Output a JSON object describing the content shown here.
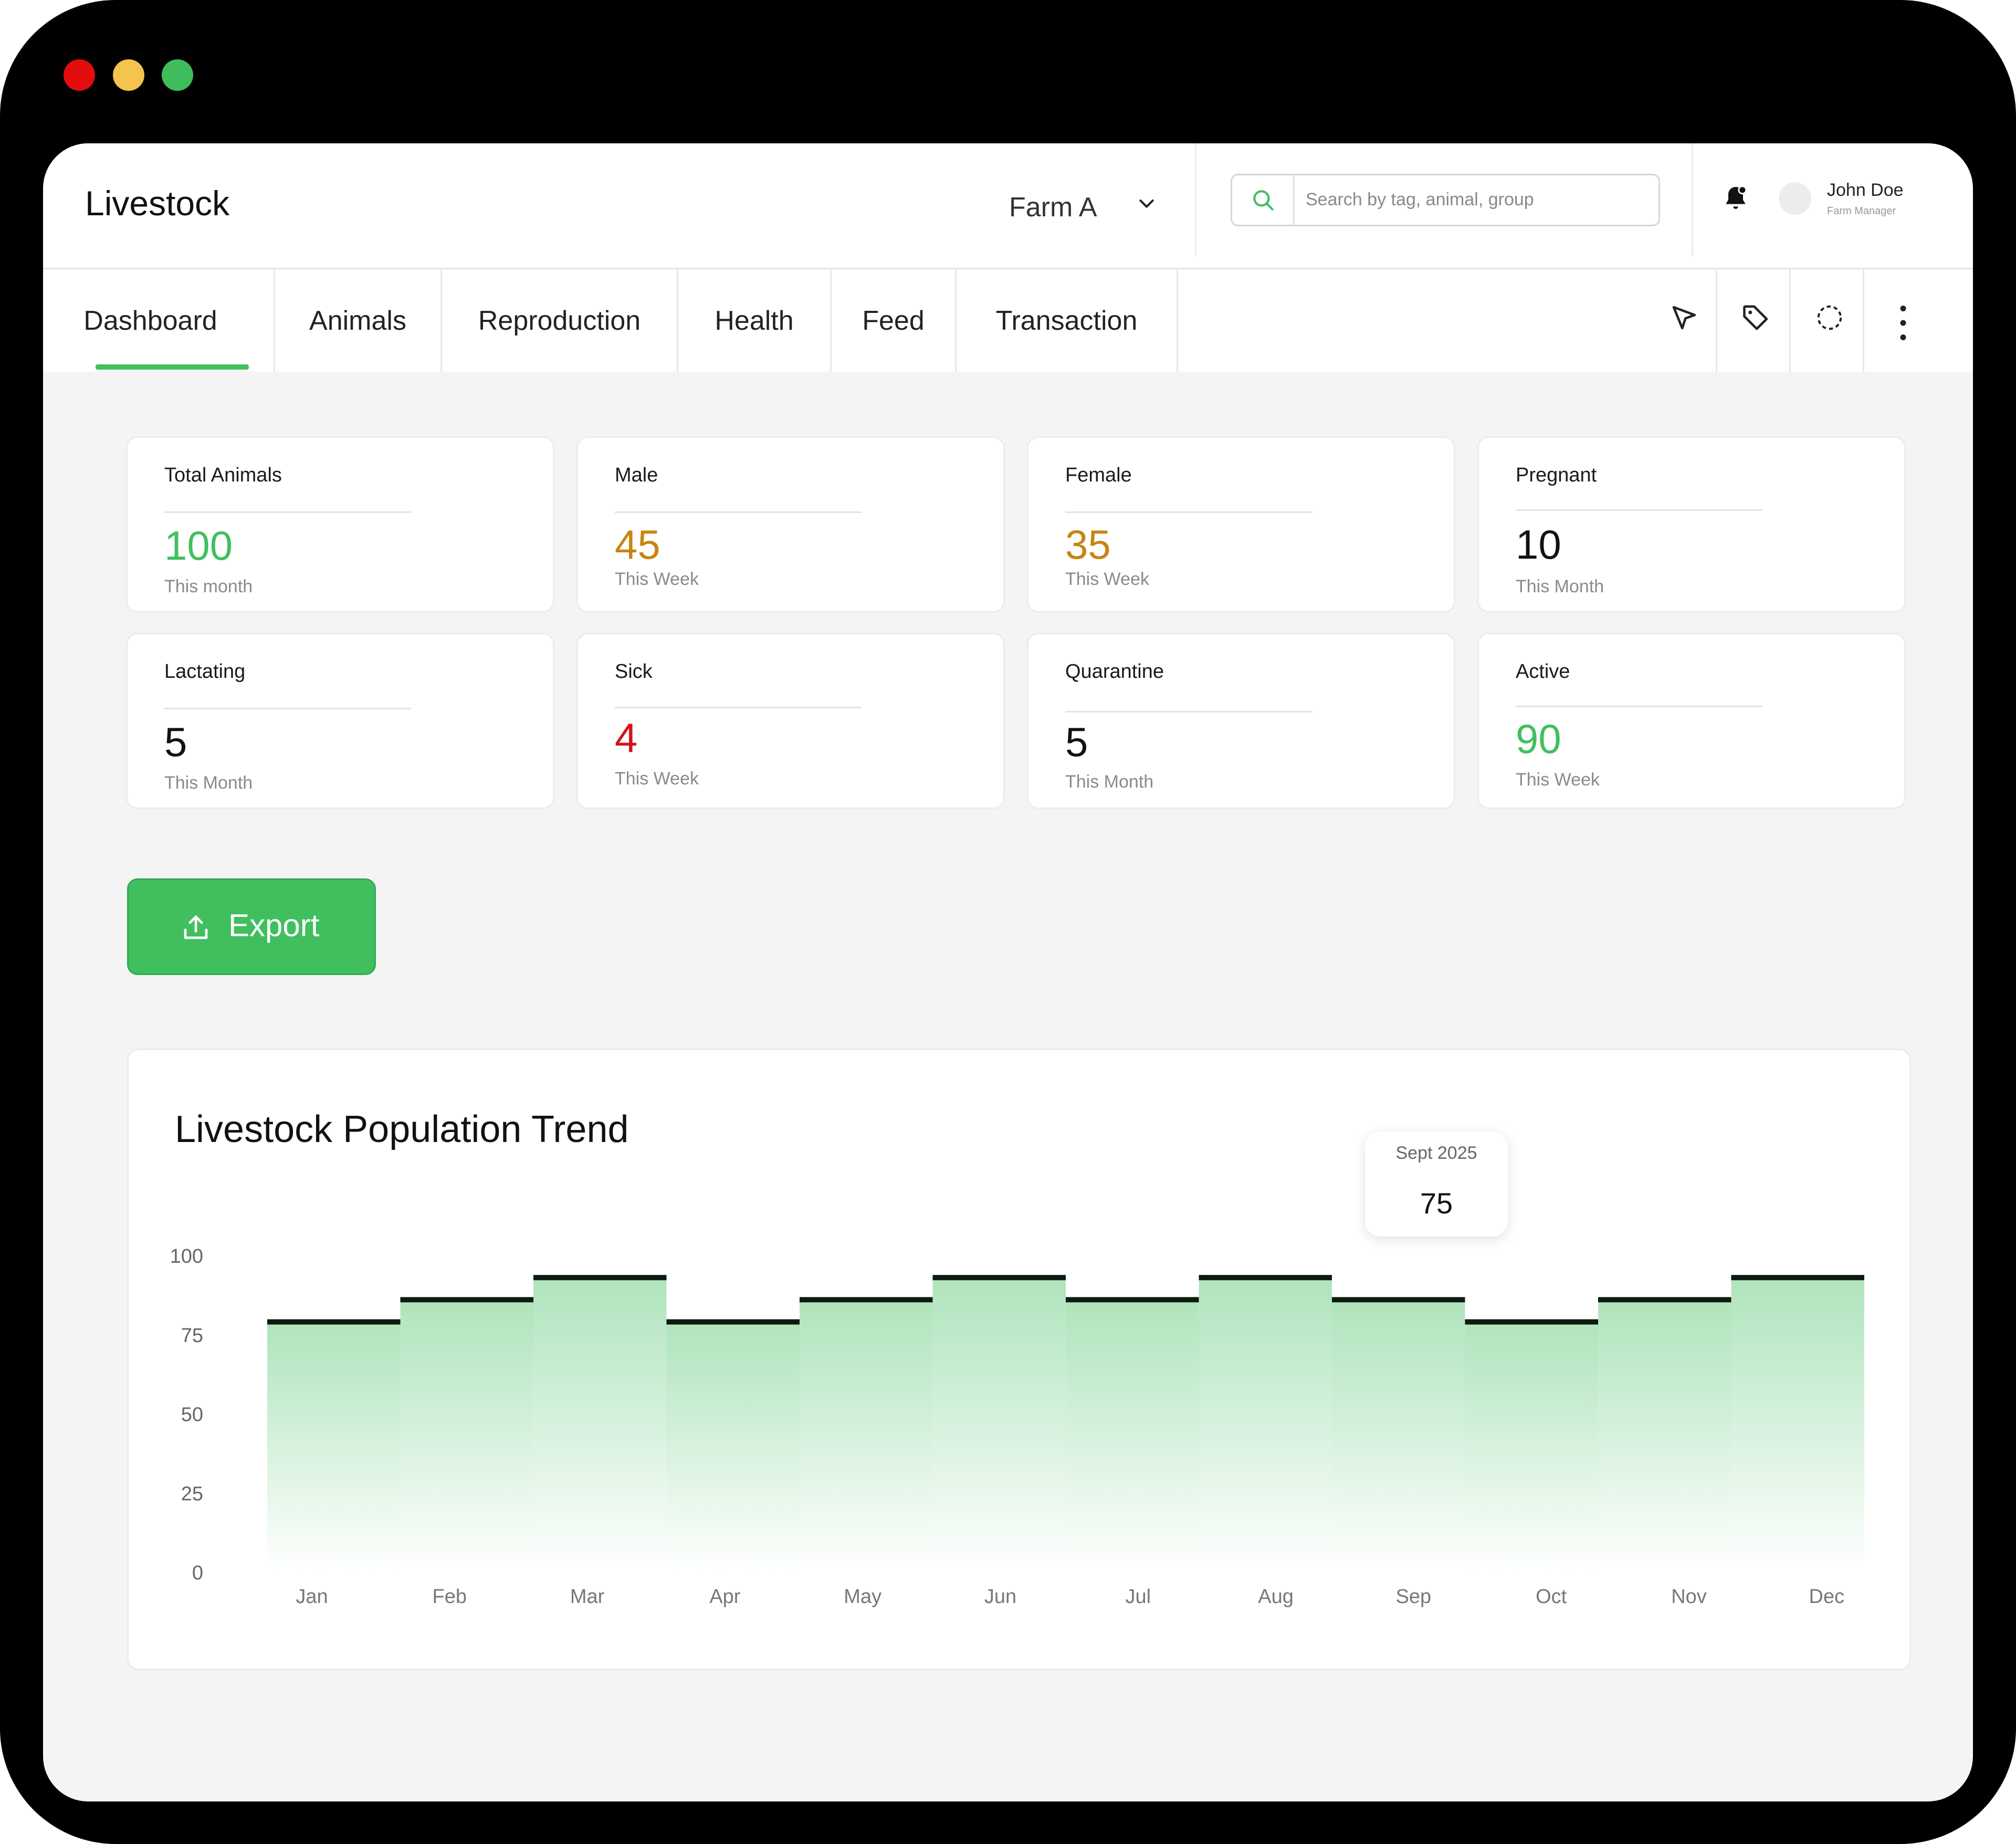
{
  "window": {
    "controls": {
      "close_color": "#e20d0d",
      "minimize_color": "#f5c44e",
      "maximize_color": "#3fbd5d"
    }
  },
  "header": {
    "title": "Livestock",
    "farm_selector": {
      "value": "Farm A",
      "icon": "chevron-down-icon"
    },
    "search": {
      "placeholder": "Search by tag, animal, group",
      "icon": "search-icon"
    },
    "notifications": {
      "icon": "bell-icon"
    },
    "user": {
      "name": "John Doe",
      "role": "Farm Manager"
    }
  },
  "tabs": [
    {
      "label": "Dashboard",
      "active": true
    },
    {
      "label": "Animals"
    },
    {
      "label": "Reproduction"
    },
    {
      "label": "Health"
    },
    {
      "label": "Feed"
    },
    {
      "label": "Transaction"
    }
  ],
  "toolbar": {
    "icons": [
      "cursor-icon",
      "tag-icon",
      "dashed-circle-icon",
      "more-vertical-icon"
    ]
  },
  "stats": [
    {
      "label": "Total Animals",
      "value": "100",
      "period": "This month",
      "color": "#40bf5f"
    },
    {
      "label": "Male",
      "value": "45",
      "period": "This Week",
      "color": "#c88512"
    },
    {
      "label": "Female",
      "value": "35",
      "period": "This Week",
      "color": "#c88512"
    },
    {
      "label": "Pregnant",
      "value": "10",
      "period": "This Month",
      "color": "#111111"
    },
    {
      "label": "Lactating",
      "value": "5",
      "period": "This Month",
      "color": "#111111"
    },
    {
      "label": "Sick",
      "value": "4",
      "period": "This Week",
      "color": "#d4121a"
    },
    {
      "label": "Quarantine",
      "value": "5",
      "period": "This Month",
      "color": "#111111"
    },
    {
      "label": "Active",
      "value": "90",
      "period": "This Week",
      "color": "#40bf5f"
    }
  ],
  "export_button": {
    "label": "Export",
    "icon": "upload-icon",
    "color": "#40bf5f"
  },
  "chart_data": {
    "type": "area",
    "title": "Livestock Population Trend",
    "categories": [
      "Jan",
      "Feb",
      "Mar",
      "Apr",
      "May",
      "Jun",
      "Jul",
      "Aug",
      "Sep",
      "Oct",
      "Nov",
      "Dec"
    ],
    "values": [
      79,
      86,
      93,
      79,
      86,
      93,
      86,
      93,
      86,
      79,
      86,
      93
    ],
    "ylim": [
      0,
      100
    ],
    "yticks": [
      0,
      25,
      50,
      75,
      100
    ],
    "grid": false,
    "step": true,
    "tooltip": {
      "label": "Sept 2025",
      "value": "75"
    },
    "fill_color": "#40bf5f",
    "line_color": "#0d1a0f"
  }
}
